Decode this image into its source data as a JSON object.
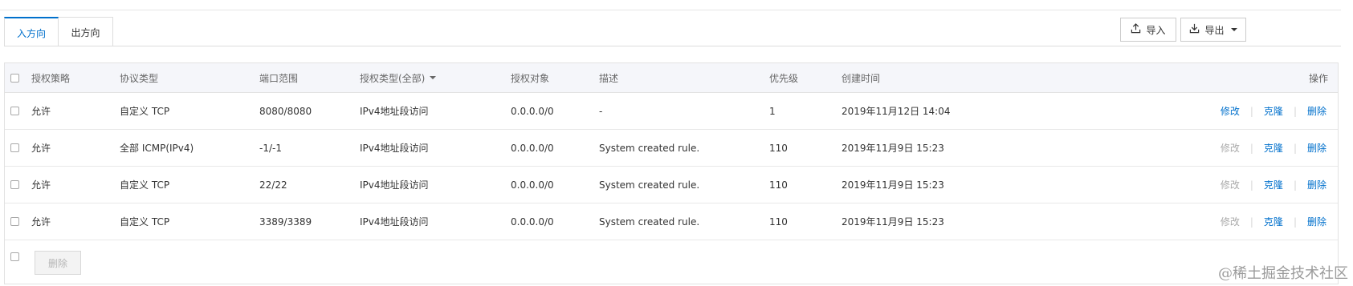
{
  "tabs": [
    {
      "label": "入方向",
      "active": true
    },
    {
      "label": "出方向",
      "active": false
    }
  ],
  "toolbar": {
    "import_label": "导入",
    "export_label": "导出",
    "import_icon": "upload-icon",
    "export_icon": "download-icon"
  },
  "table": {
    "headers": {
      "policy": "授权策略",
      "protocol": "协议类型",
      "port": "端口范围",
      "auth_type": "授权类型(全部)",
      "auth_object": "授权对象",
      "description": "描述",
      "priority": "优先级",
      "created": "创建时间",
      "ops": "操作"
    },
    "rows": [
      {
        "policy": "允许",
        "protocol": "自定义 TCP",
        "port": "8080/8080",
        "auth_type": "IPv4地址段访问",
        "auth_object": "0.0.0.0/0",
        "description": "-",
        "priority": "1",
        "created": "2019年11月12日 14:04",
        "modify": "修改",
        "clone": "克隆",
        "delete": "删除",
        "modify_enabled": true
      },
      {
        "policy": "允许",
        "protocol": "全部 ICMP(IPv4)",
        "port": "-1/-1",
        "auth_type": "IPv4地址段访问",
        "auth_object": "0.0.0.0/0",
        "description": "System created rule.",
        "priority": "110",
        "created": "2019年11月9日 15:23",
        "modify": "修改",
        "clone": "克隆",
        "delete": "删除",
        "modify_enabled": false
      },
      {
        "policy": "允许",
        "protocol": "自定义 TCP",
        "port": "22/22",
        "auth_type": "IPv4地址段访问",
        "auth_object": "0.0.0.0/0",
        "description": "System created rule.",
        "priority": "110",
        "created": "2019年11月9日 15:23",
        "modify": "修改",
        "clone": "克隆",
        "delete": "删除",
        "modify_enabled": false
      },
      {
        "policy": "允许",
        "protocol": "自定义 TCP",
        "port": "3389/3389",
        "auth_type": "IPv4地址段访问",
        "auth_object": "0.0.0.0/0",
        "description": "System created rule.",
        "priority": "110",
        "created": "2019年11月9日 15:23",
        "modify": "修改",
        "clone": "克隆",
        "delete": "删除",
        "modify_enabled": false
      }
    ],
    "footer_delete_label": "删除"
  },
  "watermark": "@稀土掘金技术社区",
  "colors": {
    "accent": "#0070cc",
    "disabled_text": "#aaaaaa",
    "header_bg": "#f5f6fa"
  }
}
